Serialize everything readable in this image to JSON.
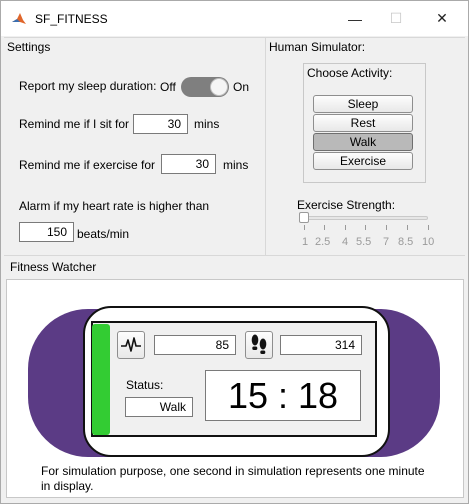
{
  "window": {
    "title": "SF_FITNESS",
    "controls": {
      "minimize": "—",
      "maximize": "☐",
      "close": "✕"
    }
  },
  "settings": {
    "panel_title": "Settings",
    "sleep": {
      "label": "Report my sleep duration:",
      "off_label": "Off",
      "on_label": "On",
      "state": "on"
    },
    "sit": {
      "label": "Remind me if I sit for",
      "value": "30",
      "unit": "mins"
    },
    "exercise": {
      "label": "Remind me if exercise for",
      "value": "30",
      "unit": "mins"
    },
    "heart": {
      "label": "Alarm if my heart rate is higher than",
      "value": "150",
      "unit": "beats/min"
    }
  },
  "simulator": {
    "panel_title": "Human Simulator:",
    "group_title": "Choose Activity:",
    "activities": [
      "Sleep",
      "Rest",
      "Walk",
      "Exercise"
    ],
    "selected_activity": "Walk",
    "strength": {
      "label": "Exercise Strength:",
      "ticks": [
        "1",
        "2.5",
        "4",
        "5.5",
        "7",
        "8.5",
        "10"
      ],
      "min": 1,
      "max": 10,
      "value": 1
    }
  },
  "watcher": {
    "panel_title": "Fitness Watcher",
    "heart_rate": "85",
    "steps": "314",
    "status_label": "Status:",
    "status_value": "Walk",
    "time": "15 : 18",
    "footer": "For simulation purpose, one second in simulation represents one minute in display.",
    "colors": {
      "band": "#5b3b85",
      "battery": "#33cc33"
    },
    "icons": {
      "heart": "heartbeat-icon",
      "steps": "footsteps-icon"
    }
  }
}
